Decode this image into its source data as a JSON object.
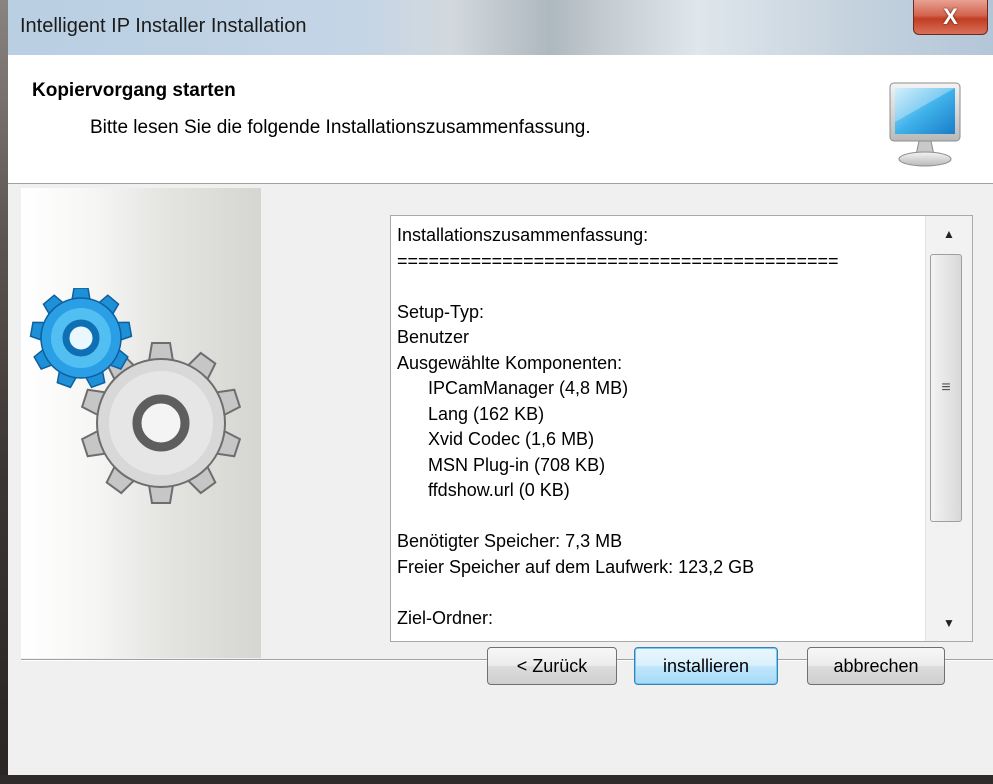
{
  "window": {
    "title": "Intelligent IP Installer Installation",
    "close_label": "X"
  },
  "header": {
    "title": "Kopiervorgang starten",
    "subtitle": "Bitte lesen Sie die folgende Installationszusammenfassung."
  },
  "summary": {
    "lines": [
      "Installationszusammenfassung:",
      "==========================================",
      "",
      "Setup-Typ:",
      "Benutzer",
      "Ausgewählte Komponenten:",
      "IPCamManager (4,8 MB)",
      "Lang (162 KB)",
      "Xvid Codec (1,6 MB)",
      "MSN Plug-in (708 KB)",
      "ffdshow.url (0 KB)",
      "",
      "Benötigter Speicher: 7,3 MB",
      "Freier Speicher auf dem Laufwerk: 123,2 GB",
      "",
      "Ziel-Ordner:"
    ],
    "indented_lines": [
      6,
      7,
      8,
      9,
      10
    ],
    "scroll_up_icon": "▲",
    "scroll_down_icon": "▼",
    "scroll_grip_icon": "≡"
  },
  "buttons": {
    "back": "< Zurück",
    "install": "installieren",
    "cancel": "abbrechen"
  },
  "colors": {
    "accent_gear": "#1e90d8",
    "gray_gear": "#c8c8c8"
  }
}
